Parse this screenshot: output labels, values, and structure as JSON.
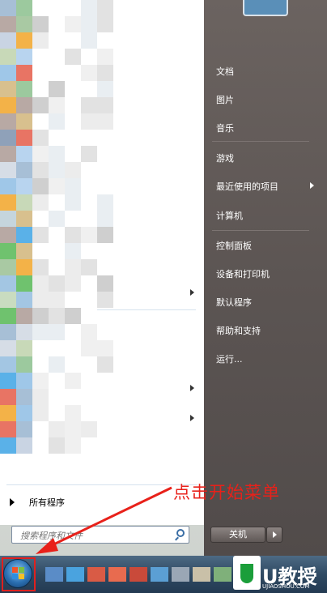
{
  "start_menu": {
    "all_programs_label": "所有程序",
    "search_placeholder": "搜索程序和文件",
    "right_items": [
      {
        "label": "文档",
        "has_submenu": false
      },
      {
        "label": "图片",
        "has_submenu": false
      },
      {
        "label": "音乐",
        "has_submenu": false
      },
      {
        "label": "游戏",
        "has_submenu": false
      },
      {
        "label": "最近使用的项目",
        "has_submenu": true
      },
      {
        "label": "计算机",
        "has_submenu": false
      },
      {
        "label": "控制面板",
        "has_submenu": false
      },
      {
        "label": "设备和打印机",
        "has_submenu": false
      },
      {
        "label": "默认程序",
        "has_submenu": false
      },
      {
        "label": "帮助和支持",
        "has_submenu": false
      },
      {
        "label": "运行...",
        "has_submenu": false
      }
    ],
    "shutdown_label": "关机"
  },
  "annotation": {
    "text": "点击开始菜单",
    "color": "#e8211a"
  },
  "watermark": {
    "brand": "U教授",
    "url": "UJIAOSHOU.COM"
  },
  "icons": [
    "windows-start-orb",
    "search-icon",
    "submenu-arrow-icon",
    "shutdown-options-arrow-icon"
  ]
}
